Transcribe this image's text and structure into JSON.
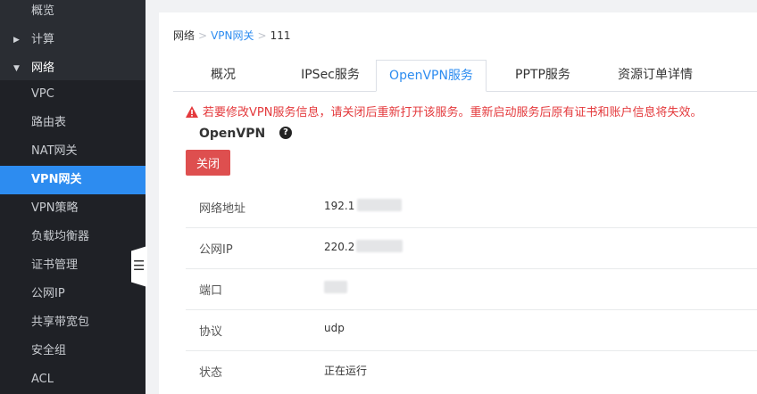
{
  "sidebar": {
    "items": [
      {
        "label": "概览"
      },
      {
        "label": "计算"
      },
      {
        "label": "网络"
      },
      {
        "label": "VPC"
      },
      {
        "label": "路由表"
      },
      {
        "label": "NAT网关"
      },
      {
        "label": "VPN网关"
      },
      {
        "label": "VPN策略"
      },
      {
        "label": "负载均衡器"
      },
      {
        "label": "证书管理"
      },
      {
        "label": "公网IP"
      },
      {
        "label": "共享带宽包"
      },
      {
        "label": "安全组"
      },
      {
        "label": "ACL"
      }
    ],
    "collapse_icon": "list-collapse-icon"
  },
  "breadcrumb": {
    "root": "网络",
    "parent": "VPN网关",
    "current": "111",
    "separator": ">"
  },
  "tabs": [
    {
      "label": "概况"
    },
    {
      "label": "IPSec服务"
    },
    {
      "label": "OpenVPN服务"
    },
    {
      "label": "PPTP服务"
    },
    {
      "label": "资源订单详情"
    }
  ],
  "warning": "若要修改VPN服务信息，请关闭后重新打开该服务。重新启动服务后原有证书和账户信息将失效。",
  "section": {
    "title": "OpenVPN",
    "help_icon": "question-circle-icon",
    "close_label": "关闭"
  },
  "details": [
    {
      "label": "网络地址",
      "value": "192.1"
    },
    {
      "label": "公网IP",
      "value": "220.2"
    },
    {
      "label": "端口",
      "value": ""
    },
    {
      "label": "协议",
      "value": "udp"
    },
    {
      "label": "状态",
      "value": "正在运行"
    }
  ],
  "colors": {
    "sidebar_bg": "#2a2d33",
    "active": "#2d8cf0",
    "danger": "#de4f4f",
    "warning_text": "#e4393c"
  }
}
